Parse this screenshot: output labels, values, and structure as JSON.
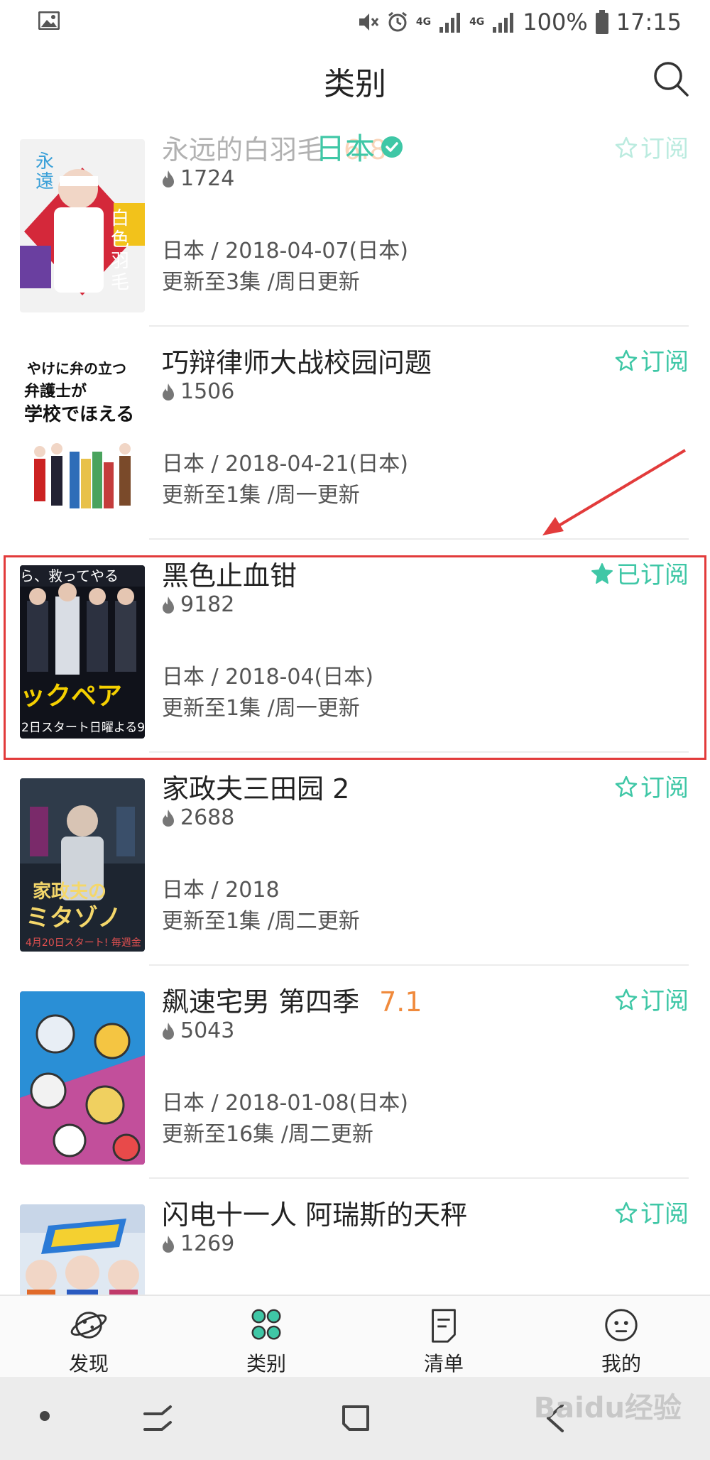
{
  "status_bar": {
    "net_label": "4G",
    "battery": "100%",
    "time": "17:15"
  },
  "header": {
    "title": "类别"
  },
  "filter": {
    "label": "日本"
  },
  "items": [
    {
      "title": "永远的白羽毛",
      "rating": "6.8",
      "heat": "1724",
      "meta1": "日本 / 2018-04-07(日本)",
      "meta2": "更新至3集 /周日更新",
      "sub_label": "订阅",
      "subscribed": false
    },
    {
      "title": "巧辩律师大战校园问题",
      "rating": "",
      "heat": "1506",
      "meta1": "日本 / 2018-04-21(日本)",
      "meta2": "更新至1集 /周一更新",
      "sub_label": "订阅",
      "subscribed": false
    },
    {
      "title": "黑色止血钳",
      "rating": "",
      "heat": "9182",
      "meta1": "日本 / 2018-04(日本)",
      "meta2": "更新至1集 /周一更新",
      "sub_label": "已订阅",
      "subscribed": true
    },
    {
      "title": "家政夫三田园 2",
      "rating": "",
      "heat": "2688",
      "meta1": "日本 / 2018",
      "meta2": "更新至1集 /周二更新",
      "sub_label": "订阅",
      "subscribed": false
    },
    {
      "title": "飙速宅男 第四季",
      "rating": "7.1",
      "heat": "5043",
      "meta1": "日本 / 2018-01-08(日本)",
      "meta2": "更新至16集 /周二更新",
      "sub_label": "订阅",
      "subscribed": false
    },
    {
      "title": "闪电十一人 阿瑞斯的天秤",
      "rating": "",
      "heat": "1269",
      "meta1": "",
      "meta2": "",
      "sub_label": "订阅",
      "subscribed": false
    }
  ],
  "tabs": [
    {
      "label": "发现",
      "icon": "planet-icon"
    },
    {
      "label": "类别",
      "icon": "grid-circles-icon"
    },
    {
      "label": "清单",
      "icon": "list-doc-icon"
    },
    {
      "label": "我的",
      "icon": "face-icon"
    }
  ],
  "colors": {
    "accent": "#3fc7a6",
    "rating": "#f08a3c",
    "highlight": "#e23b3b"
  },
  "watermark": "Baidu经验"
}
